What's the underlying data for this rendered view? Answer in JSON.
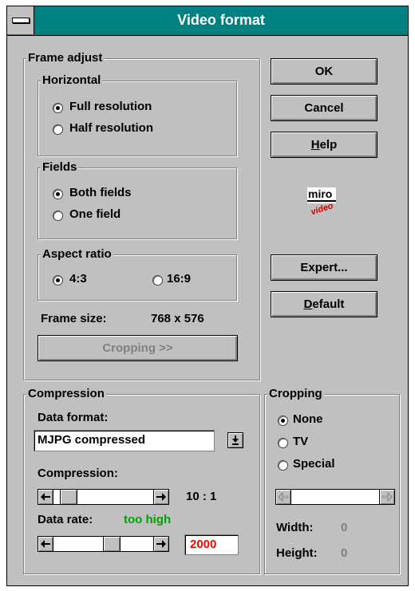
{
  "window": {
    "title": "Video format"
  },
  "frame_adjust": {
    "label": "Frame adjust",
    "horizontal": {
      "label": "Horizontal",
      "options": [
        "Full resolution",
        "Half resolution"
      ],
      "selected": 0
    },
    "fields": {
      "label": "Fields",
      "options": [
        "Both fields",
        "One field"
      ],
      "selected": 0
    },
    "aspect": {
      "label": "Aspect ratio",
      "options": [
        "4:3",
        "16:9"
      ],
      "selected": 0
    },
    "frame_size_label": "Frame size:",
    "frame_size_value": "768 x 576",
    "cropping_button": "Cropping >>"
  },
  "buttons": {
    "ok": "OK",
    "cancel": "Cancel",
    "help_first": "H",
    "help_rest": "elp",
    "expert": "Expert...",
    "default_first": "D",
    "default_rest": "efault"
  },
  "logo": {
    "text1": "miro",
    "text2": "video"
  },
  "compression": {
    "label": "Compression",
    "data_format_label": "Data format:",
    "data_format_value": "MJPG compressed",
    "compression_label": "Compression:",
    "ratio": "10 : 1",
    "data_rate_label": "Data rate:",
    "data_rate_status": "too high",
    "data_rate_value": "2000",
    "compression_slider_level": 0.08,
    "data_rate_slider_level": 0.6,
    "status_color": "#00a000",
    "value_color": "#ff0000"
  },
  "cropping": {
    "label": "Cropping",
    "options": [
      "None",
      "TV",
      "Special"
    ],
    "selected": 0,
    "width_label": "Width:",
    "width_value": "0",
    "height_label": "Height:",
    "height_value": "0"
  }
}
